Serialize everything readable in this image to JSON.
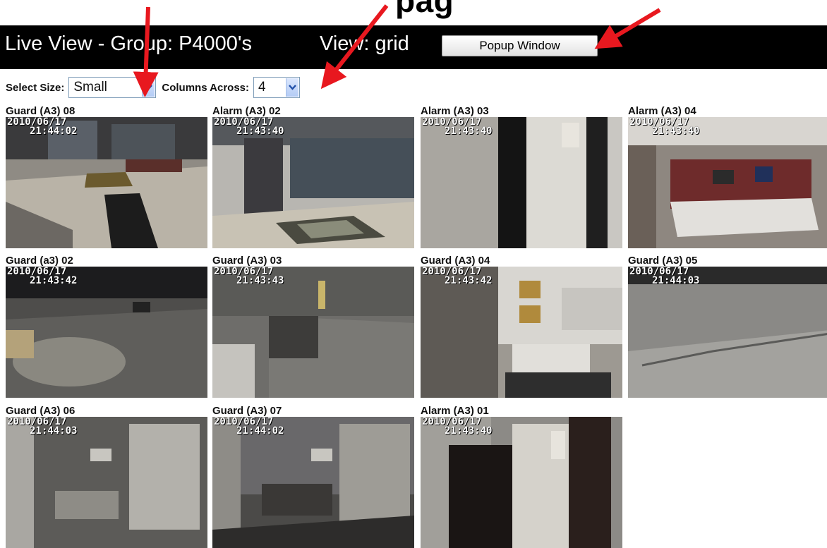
{
  "annotation": {
    "title_fragment": "pag"
  },
  "header": {
    "title": "Live View - Group: P4000's",
    "view": "View: grid",
    "popup_button": "Popup Window"
  },
  "controls": {
    "size_label": "Select Size:",
    "size_value": "Small",
    "columns_label": "Columns Across:",
    "columns_value": "4"
  },
  "cameras": [
    {
      "label": "Guard (A3) 08",
      "date": "2010/06/17",
      "time": "21:44:02",
      "scene": "lobby"
    },
    {
      "label": "Alarm (A3) 02",
      "date": "2010/06/17",
      "time": "21:43:40",
      "scene": "entrance"
    },
    {
      "label": "Alarm (A3) 03",
      "date": "2010/06/17",
      "time": "21:43:40",
      "scene": "hallway-door"
    },
    {
      "label": "Alarm (A3) 04",
      "date": "2010/06/17",
      "time": "21:43:40",
      "scene": "office"
    },
    {
      "label": "Guard (a3) 02",
      "date": "2010/06/17",
      "time": "21:43:42",
      "scene": "parking-lot"
    },
    {
      "label": "Guard (A3) 03",
      "date": "2010/06/17",
      "time": "21:43:43",
      "scene": "loading-dock"
    },
    {
      "label": "Guard (A3) 04",
      "date": "2010/06/17",
      "time": "21:43:42",
      "scene": "reception"
    },
    {
      "label": "Guard (A3) 05",
      "date": "2010/06/17",
      "time": "21:44:03",
      "scene": "exterior-night"
    },
    {
      "label": "Guard (A3) 06",
      "date": "2010/06/17",
      "time": "21:44:03",
      "scene": "kitchen"
    },
    {
      "label": "Guard (A3) 07",
      "date": "2010/06/17",
      "time": "21:44:02",
      "scene": "break-room"
    },
    {
      "label": "Alarm (A3) 01",
      "date": "2010/06/17",
      "time": "21:43:40",
      "scene": "doorway"
    }
  ],
  "colors": {
    "header_bg": "#000000",
    "arrow": "#e8181f",
    "select_border": "#7f9db9"
  }
}
